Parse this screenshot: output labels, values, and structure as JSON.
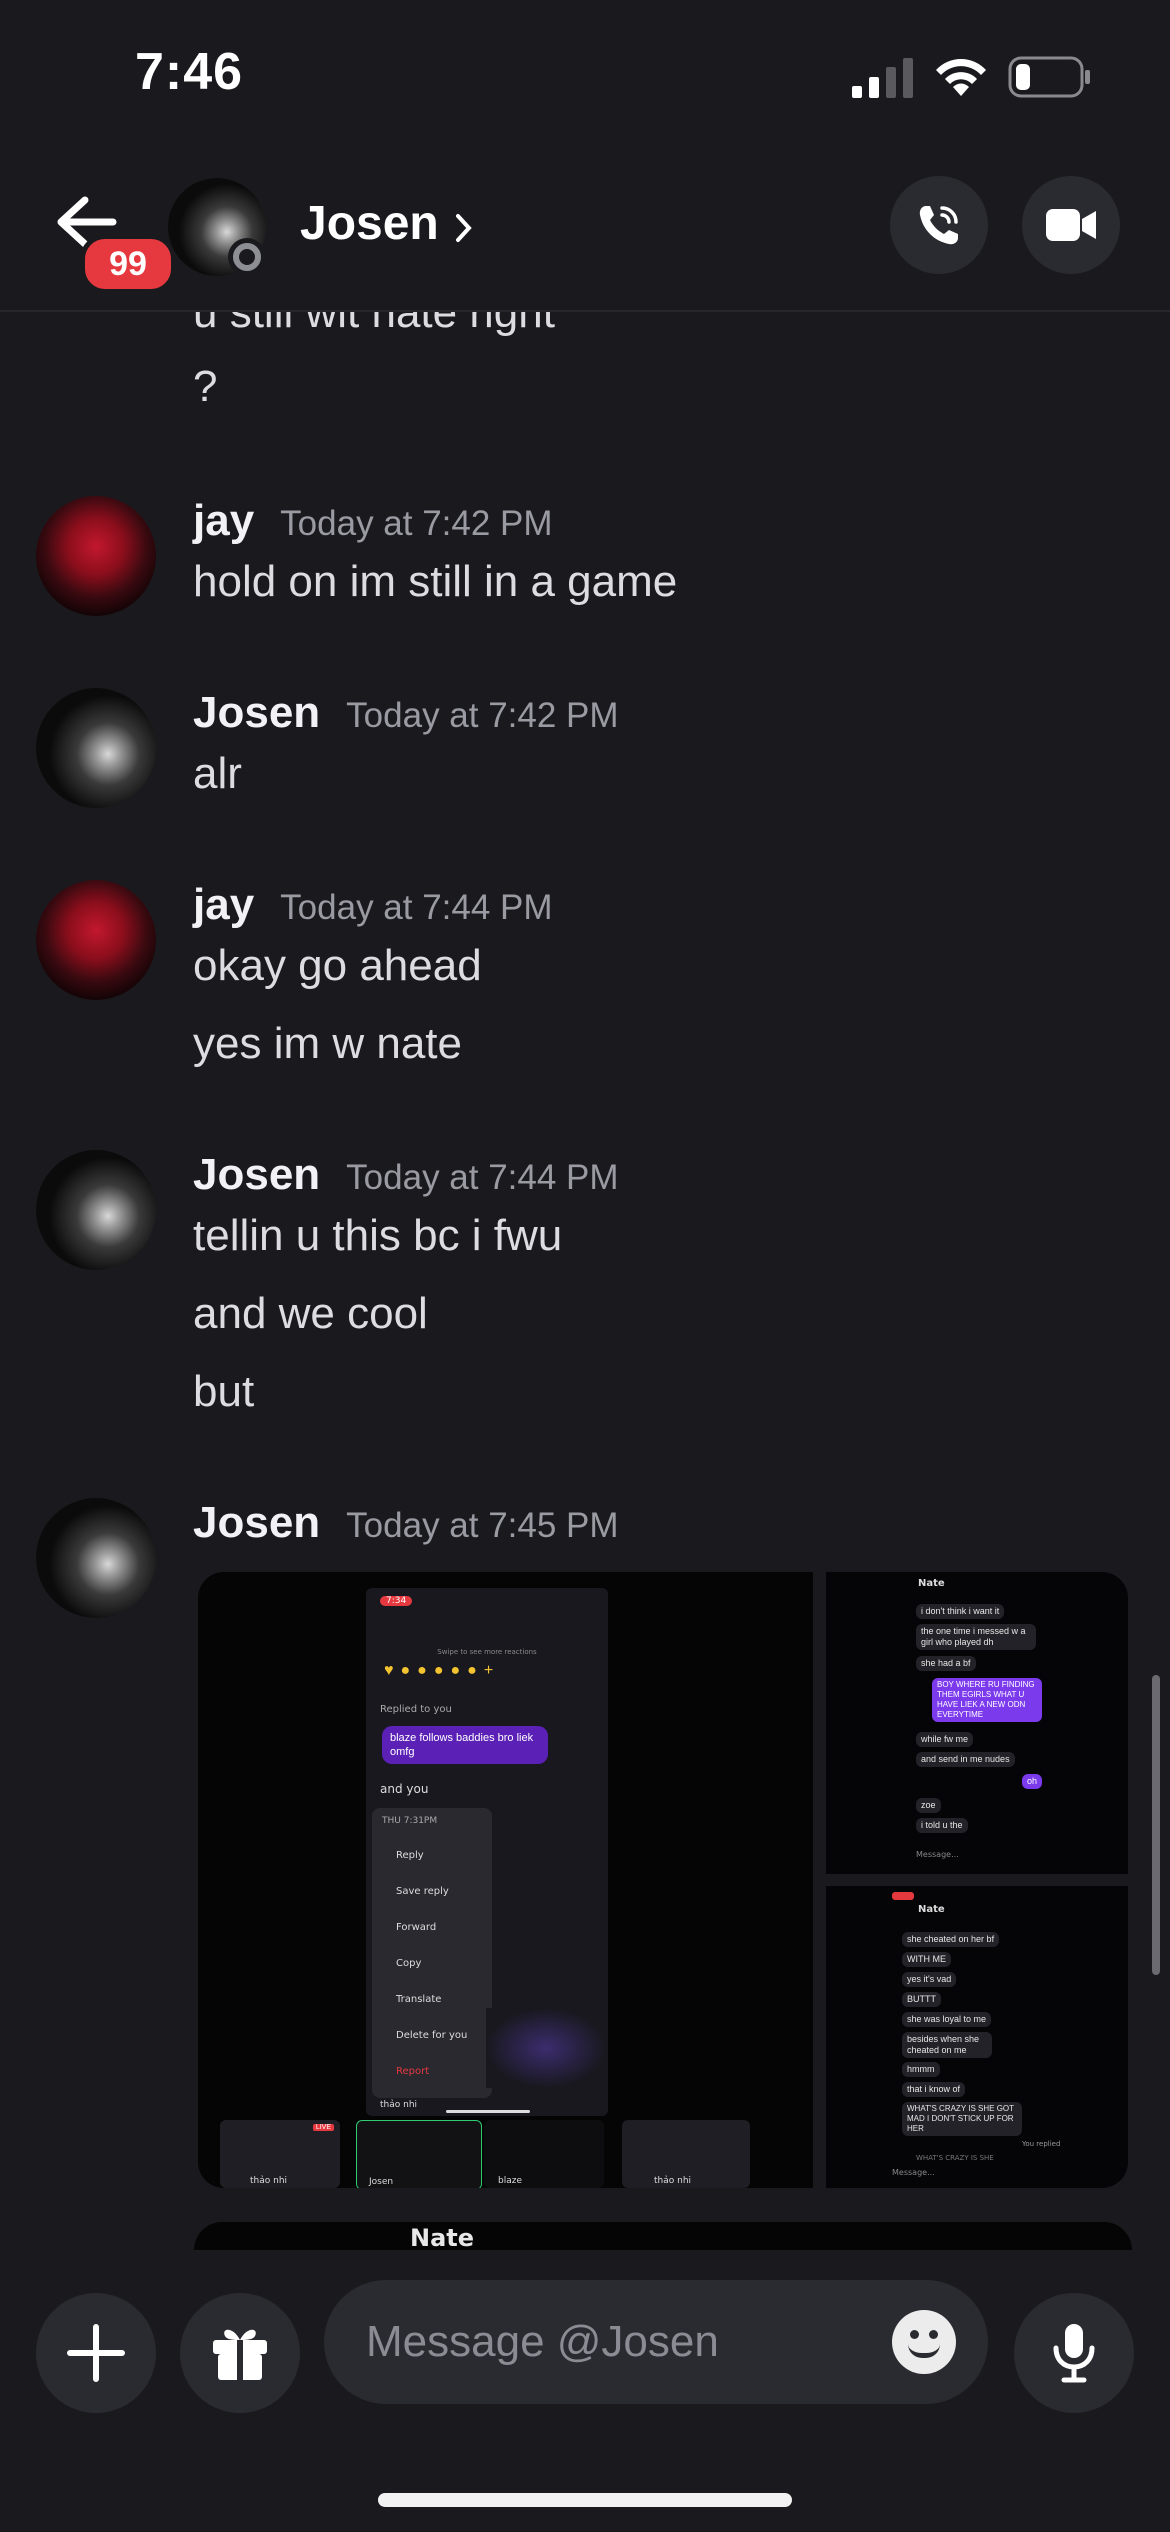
{
  "status_bar": {
    "time": "7:46"
  },
  "header": {
    "back_badge": "99",
    "contact_name": "Josen",
    "chevron": "›"
  },
  "messages": {
    "partial_top": "u still wit nate right",
    "partial_q": "?",
    "groups": [
      {
        "author": "jay",
        "timestamp": "Today at 7:42 PM",
        "lines": [
          "hold on im still in a game"
        ]
      },
      {
        "author": "Josen",
        "timestamp": "Today at 7:42 PM",
        "lines": [
          "alr"
        ]
      },
      {
        "author": "jay",
        "timestamp": "Today at 7:44 PM",
        "lines": [
          "okay go ahead",
          "yes im w nate"
        ]
      },
      {
        "author": "Josen",
        "timestamp": "Today at 7:44 PM",
        "lines": [
          "tellin u this bc i fwu",
          "and we cool",
          "but"
        ]
      },
      {
        "author": "Josen",
        "timestamp": "Today at 7:45 PM",
        "lines": []
      }
    ]
  },
  "screenshot_main": {
    "time": "7:34",
    "swipe_hint": "Swipe to see more reactions",
    "replied_label": "Replied to you",
    "reply_bubble": "blaze follows baddies bro liek omfg",
    "and_you": "and you",
    "menu_header": "THU 7:31PM",
    "menu_items": [
      "Reply",
      "Save reply",
      "Forward",
      "Copy",
      "Translate",
      "Delete for you",
      "Report"
    ],
    "bottom_name": "thảo nhi",
    "thumbs": [
      "thảo nhi",
      "Josen",
      "blaze",
      "thảo nhi"
    ],
    "live_label": "LIVE"
  },
  "screenshot_side1": {
    "name": "Nate",
    "bubbles": [
      "i don't think i want it",
      "the one time i messed w a girl who played dh",
      "she had a bf",
      "BOY WHERE RU FINDING THEM EGIRLS WHAT U HAVE LIEK A NEW ODN EVERYTIME",
      "while fw me",
      "and send in me nudes",
      "oh",
      "zoe",
      "i told u the",
      "Message..."
    ]
  },
  "screenshot_side2": {
    "name": "Nate",
    "bubbles": [
      "she cheated on her bf",
      "WITH ME",
      "yes it's vad",
      "BUTTT",
      "she was loyal to me",
      "besides when she cheated on me",
      "hmmm",
      "that i know of",
      "WHAT'S CRAZY IS SHE GOT MAD I DON'T STICK UP FOR HER",
      "You replied",
      "WHAT'S CRAZY IS SHE",
      "Message..."
    ]
  },
  "next_attachment": {
    "name": "Nate"
  },
  "composer": {
    "placeholder": "Message @Josen"
  },
  "colors": {
    "background": "#1a1a1e",
    "accent": "#7c3aed",
    "badge": "#e5393f",
    "input": "#2a2a31"
  },
  "icons": [
    "back-arrow-icon",
    "chevron-right-icon",
    "phone-call-icon",
    "video-camera-icon",
    "plus-icon",
    "gift-icon",
    "emoji-icon",
    "microphone-icon",
    "signal-icon",
    "wifi-icon",
    "battery-icon"
  ]
}
